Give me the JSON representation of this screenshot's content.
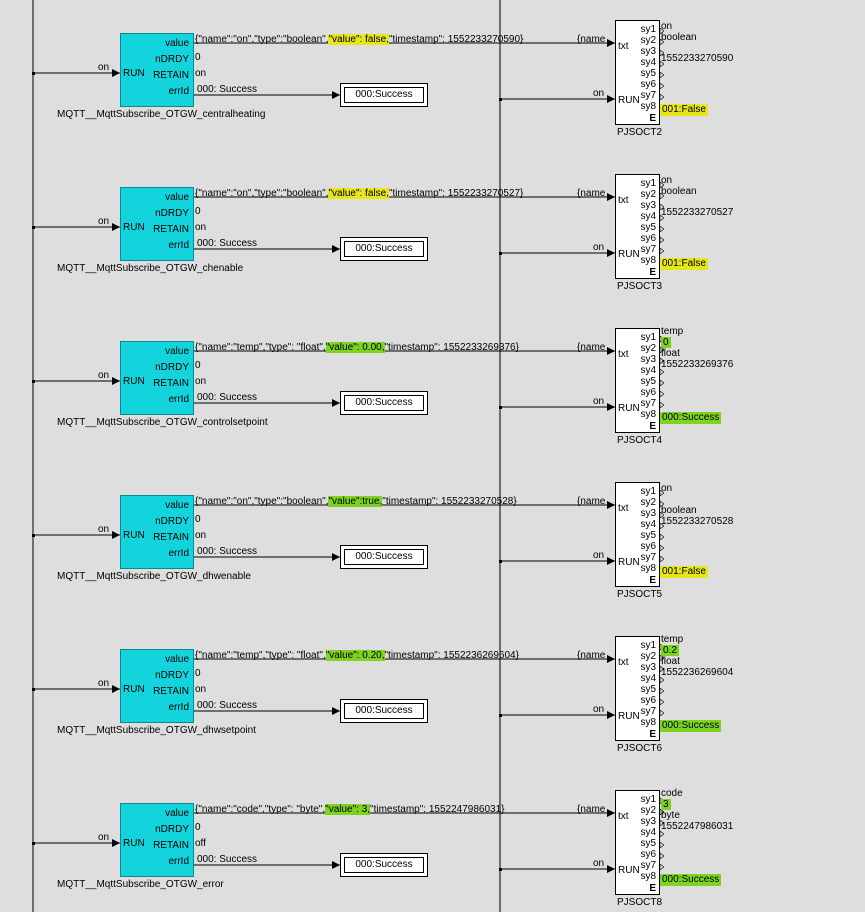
{
  "colors": {
    "block": "#13d4dc",
    "highlight_yellow": "#e6e61a",
    "highlight_green": "#7ed321",
    "background": "#dedede"
  },
  "subscribe_ports": {
    "value": "value",
    "ndrdy": "nDRDY",
    "retain": "RETAIN",
    "errid": "errId",
    "run": "RUN",
    "ndrdy_out": "0"
  },
  "pj_ports": {
    "sy1": "sy1",
    "sy2": "sy2",
    "sy3": "sy3",
    "sy4": "sy4",
    "sy5": "sy5",
    "sy6": "sy6",
    "sy7": "sy7",
    "sy8": "sy8",
    "e": "E",
    "txt": "txt",
    "run": "RUN",
    "name_in": "{name"
  },
  "rows": [
    {
      "run_in": "on",
      "block_name": "MQTT__MqttSubscribe_OTGW_centralheating",
      "json_pre": "{\"name\":\"on\",\"type\":\"boolean\",",
      "json_val": "\"value\": false,",
      "json_post": "\"timestamp\": 1552233270590}",
      "val_hl": "yellow",
      "retain_out": "on",
      "errid_out": "000: Success",
      "result_box": "000:Success",
      "pj_run_in": "on",
      "pj_name": "PJSOCT2",
      "outs": [
        "on",
        "boolean",
        "1552233270590"
      ],
      "out_hl": "",
      "e_out": "001:False",
      "e_hl": "yellow"
    },
    {
      "run_in": "on",
      "block_name": "MQTT__MqttSubscribe_OTGW_chenable",
      "json_pre": "{\"name\":\"on\",\"type\":\"boolean\",",
      "json_val": "\"value\": false,",
      "json_post": "\"timestamp\": 1552233270527}",
      "val_hl": "yellow",
      "retain_out": "on",
      "errid_out": "000: Success",
      "result_box": "000:Success",
      "pj_run_in": "on",
      "pj_name": "PJSOCT3",
      "outs": [
        "on",
        "boolean",
        "1552233270527"
      ],
      "out_hl": "",
      "e_out": "001:False",
      "e_hl": "yellow"
    },
    {
      "run_in": "on",
      "block_name": "MQTT__MqttSubscribe_OTGW_controlsetpoint",
      "json_pre": "{\"name\":\"temp\",\"type\": \"float\",",
      "json_val": "\"value\": 0.00,",
      "json_post": "\"timestamp\": 1552233269376}",
      "val_hl": "green",
      "retain_out": "on",
      "errid_out": "000: Success",
      "result_box": "000:Success",
      "pj_run_in": "on",
      "pj_name": "PJSOCT4",
      "outs": [
        "temp",
        "0",
        "float",
        "1552233269376"
      ],
      "out_hl": "0",
      "e_out": "000:Success",
      "e_hl": "green"
    },
    {
      "run_in": "on",
      "block_name": "MQTT__MqttSubscribe_OTGW_dhwenable",
      "json_pre": "{\"name\":\"on\",\"type\":\"boolean\",",
      "json_val": "\"value\":true,",
      "json_post": "\"timestamp\": 1552233270528}",
      "val_hl": "green",
      "retain_out": "on",
      "errid_out": "000: Success",
      "result_box": "000:Success",
      "pj_run_in": "on",
      "pj_name": "PJSOCT5",
      "outs": [
        "on",
        "",
        "boolean",
        "1552233270528"
      ],
      "out_hl": "",
      "e_out": "001:False",
      "e_hl": "yellow"
    },
    {
      "run_in": "on",
      "block_name": "MQTT__MqttSubscribe_OTGW_dhwsetpoint",
      "json_pre": "{\"name\":\"temp\",\"type\": \"float\",",
      "json_val": "\"value\": 0.20,",
      "json_post": "\"timestamp\": 1552236269604}",
      "val_hl": "green",
      "retain_out": "on",
      "errid_out": "000: Success",
      "result_box": "000:Success",
      "pj_run_in": "on",
      "pj_name": "PJSOCT6",
      "outs": [
        "temp",
        "0.2",
        "float",
        "1552236269604"
      ],
      "out_hl": "0.2",
      "e_out": "000:Success",
      "e_hl": "green"
    },
    {
      "run_in": "on",
      "block_name": "MQTT__MqttSubscribe_OTGW_error",
      "json_pre": "{\"name\":\"code\",\"type\": \"byte\",",
      "json_val": "\"value\": 3,",
      "json_post": "\"timestamp\": 1552247986031}",
      "val_hl": "green",
      "retain_out": "off",
      "errid_out": "000: Success",
      "result_box": "000:Success",
      "pj_run_in": "on",
      "pj_name": "PJSOCT8",
      "outs": [
        "code",
        "3",
        "byte",
        "1552247986031"
      ],
      "out_hl": "3",
      "e_out": "000:Success",
      "e_hl": "green"
    }
  ]
}
